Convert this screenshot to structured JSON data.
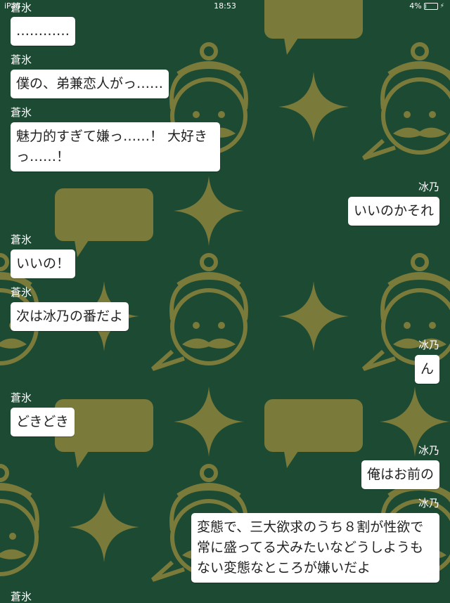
{
  "status_bar": {
    "carrier": "iPad",
    "time": "18:53",
    "battery_text": "4%",
    "battery_level": 0.04,
    "charging_icon": "bolt-icon"
  },
  "theme": {
    "background": "#1d4a33",
    "pattern": "#7a7a3a",
    "bubble": "#ffffff",
    "text": "#222222"
  },
  "messages": [
    {
      "sender": "蒼氷",
      "text": "…………",
      "side": "left"
    },
    {
      "sender": "蒼氷",
      "text": "僕の、弟兼恋人がっ……",
      "side": "left"
    },
    {
      "sender": "蒼氷",
      "text": "魅力的すぎて嫌っ……！ 大好きっ……！",
      "side": "left"
    },
    {
      "sender": "冰乃",
      "text": "いいのかそれ",
      "side": "right"
    },
    {
      "sender": "蒼氷",
      "text": "いいの！",
      "side": "left"
    },
    {
      "sender": "蒼氷",
      "text": "次は冰乃の番だよ",
      "side": "left"
    },
    {
      "sender": "冰乃",
      "text": "ん",
      "side": "right"
    },
    {
      "sender": "蒼氷",
      "text": "どきどき",
      "side": "left"
    },
    {
      "sender": "冰乃",
      "text": "俺はお前の",
      "side": "right"
    },
    {
      "sender": "冰乃",
      "text": "変態で、三大欲求のうち８割が性欲で常に盛ってる犬みたいなどうしようもない変態なところが嫌いだよ",
      "side": "right"
    },
    {
      "sender": "蒼氷",
      "text": "",
      "side": "left"
    }
  ]
}
